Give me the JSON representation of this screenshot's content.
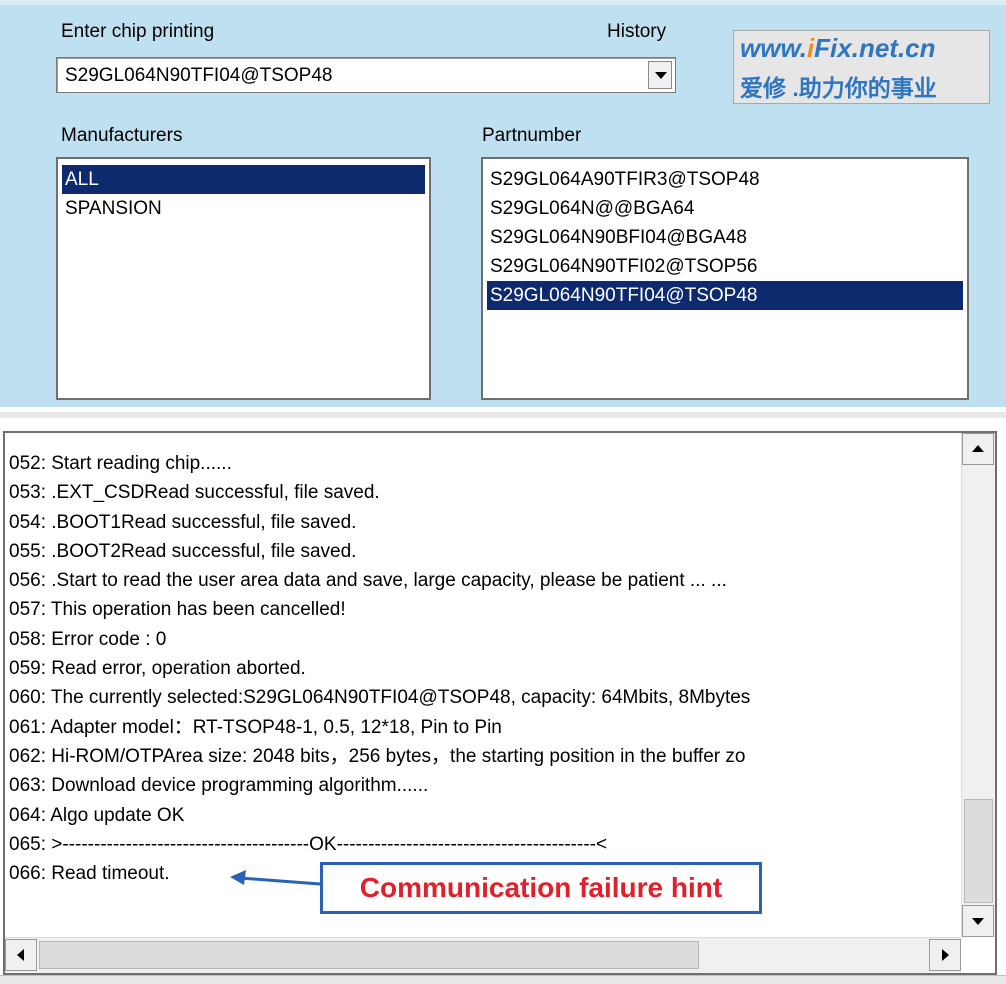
{
  "labels": {
    "enter_chip": "Enter chip printing",
    "history": "History",
    "manufacturers": "Manufacturers",
    "partnumber": "Partnumber"
  },
  "chip_input": {
    "value": "S29GL064N90TFI04@TSOP48"
  },
  "logo": {
    "url_pre": "www.",
    "url_accent": "i",
    "url_post": "Fix.net.cn",
    "tagline": "爱修 .助力你的事业"
  },
  "manufacturers": [
    "ALL",
    "SPANSION"
  ],
  "manufacturers_selected": "ALL",
  "partnumbers": [
    "S29GL064A90TFIR3@TSOP48",
    "S29GL064N@@BGA64",
    "S29GL064N90BFI04@BGA48",
    "S29GL064N90TFI02@TSOP56",
    "S29GL064N90TFI04@TSOP48"
  ],
  "partnumbers_selected": "S29GL064N90TFI04@TSOP48",
  "log": [
    "052: Start reading chip......",
    "053: .EXT_CSDRead successful, file saved.",
    "054: .BOOT1Read successful, file saved.",
    "055: .BOOT2Read successful, file saved.",
    "056: .Start to read the user area data and save, large capacity, please be patient ... ...",
    "057: This operation has been cancelled!",
    "058: Error code : 0",
    "059: Read error, operation aborted.",
    "060: The currently selected:S29GL064N90TFI04@TSOP48, capacity: 64Mbits, 8Mbytes",
    "061: Adapter model：RT-TSOP48-1, 0.5, 12*18, Pin to Pin",
    "062: Hi-ROM/OTPArea size: 2048 bits，256 bytes，the starting position in the buffer zo",
    "063: Download device programming algorithm......",
    "064: Algo update OK",
    "065: >---------------------------------------OK-----------------------------------------<",
    "066: Read timeout."
  ],
  "annotation": {
    "text": "Communication failure hint"
  },
  "colors": {
    "panel_bg": "#bfe0f0",
    "selection": "#0c2a6d",
    "annotation_text": "#e0202a",
    "annotation_border": "#2a62b8"
  }
}
